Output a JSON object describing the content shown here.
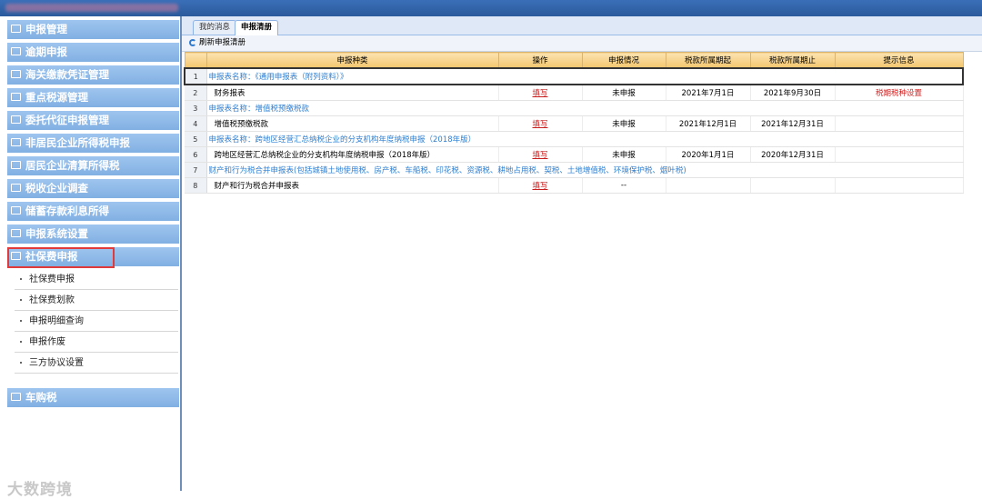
{
  "sidebar": {
    "items": [
      {
        "label": "申报管理"
      },
      {
        "label": "逾期申报"
      },
      {
        "label": "海关缴款凭证管理"
      },
      {
        "label": "重点税源管理"
      },
      {
        "label": "委托代征申报管理"
      },
      {
        "label": "非居民企业所得税申报"
      },
      {
        "label": "居民企业清算所得税"
      },
      {
        "label": "税收企业调查"
      },
      {
        "label": "储蓄存款利息所得"
      },
      {
        "label": "申报系统设置"
      },
      {
        "label": "社保费申报"
      }
    ],
    "subitems": [
      {
        "label": "社保费申报"
      },
      {
        "label": "社保费划款"
      },
      {
        "label": "申报明细查询"
      },
      {
        "label": "申报作废"
      },
      {
        "label": "三方协议设置"
      }
    ],
    "bottom_item": {
      "label": "车购税"
    }
  },
  "watermark": "大数跨境",
  "tabs": [
    {
      "label": "我的消息"
    },
    {
      "label": "申报清册"
    }
  ],
  "toolbar": {
    "refresh_label": "刷新申报清册"
  },
  "table": {
    "headers": [
      "申报种类",
      "操作",
      "申报情况",
      "税款所属期起",
      "税款所属期止",
      "提示信息"
    ],
    "rows": [
      {
        "num": "1",
        "group": "申报表名称：《通用申报表（附列资料）》"
      },
      {
        "num": "2",
        "name": "财务报表",
        "action": "填写",
        "status": "未申报",
        "start": "2021年7月1日",
        "end": "2021年9月30日",
        "tip": "税期税种设置"
      },
      {
        "num": "3",
        "group": "申报表名称：增值税预缴税款"
      },
      {
        "num": "4",
        "name": "增值税预缴税款",
        "action": "填写",
        "status": "未申报",
        "start": "2021年12月1日",
        "end": "2021年12月31日",
        "tip": ""
      },
      {
        "num": "5",
        "group": "申报表名称：跨地区经营汇总纳税企业的分支机构年度纳税申报（2018年版）"
      },
      {
        "num": "6",
        "name": "跨地区经营汇总纳税企业的分支机构年度纳税申报（2018年版）",
        "action": "填写",
        "status": "未申报",
        "start": "2020年1月1日",
        "end": "2020年12月31日",
        "tip": ""
      },
      {
        "num": "7",
        "group": "财产和行为税合并申报表(包括城镇土地使用税、房产税、车船税、印花税、资源税、耕地占用税、契税、土地增值税、环境保护税、烟叶税)"
      },
      {
        "num": "8",
        "name": "财产和行为税合并申报表",
        "action": "填写",
        "status": "--",
        "start": "",
        "end": "",
        "tip": ""
      }
    ]
  }
}
